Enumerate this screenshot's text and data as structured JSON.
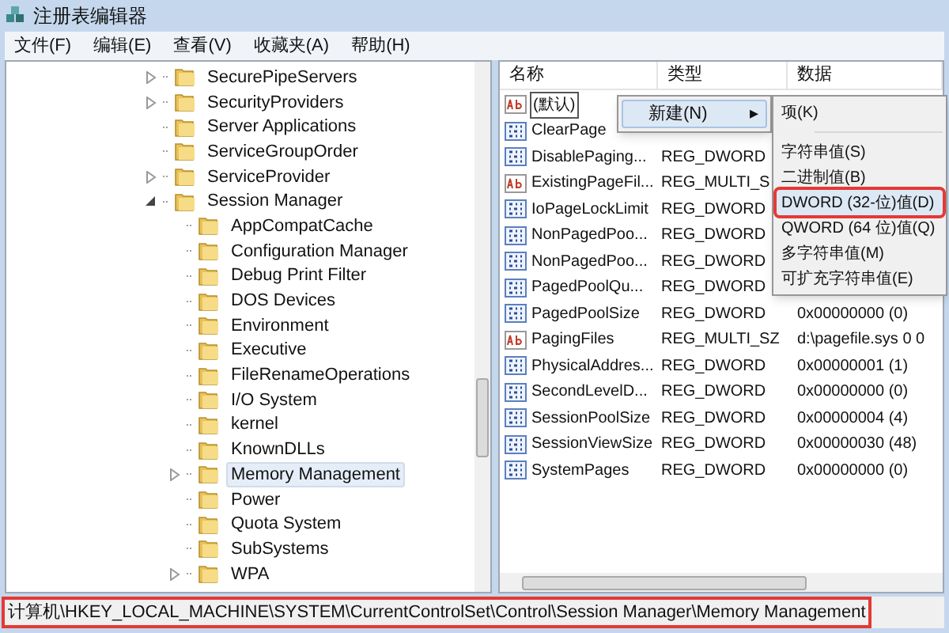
{
  "window": {
    "title": "注册表编辑器"
  },
  "menu": [
    "文件(F)",
    "编辑(E)",
    "查看(V)",
    "收藏夹(A)",
    "帮助(H)"
  ],
  "tree": [
    {
      "label": "SecurePipeServers",
      "expandable": true,
      "expanded": false,
      "selected": false
    },
    {
      "label": "SecurityProviders",
      "expandable": true,
      "expanded": false,
      "selected": false
    },
    {
      "label": "Server Applications",
      "expandable": false,
      "selected": false
    },
    {
      "label": "ServiceGroupOrder",
      "expandable": false,
      "selected": false
    },
    {
      "label": "ServiceProvider",
      "expandable": true,
      "expanded": false,
      "selected": false
    },
    {
      "label": "Session Manager",
      "expandable": true,
      "expanded": true,
      "selected": false,
      "children": [
        {
          "label": "AppCompatCache",
          "expandable": false,
          "selected": false
        },
        {
          "label": "Configuration Manager",
          "expandable": false,
          "selected": false
        },
        {
          "label": "Debug Print Filter",
          "expandable": false,
          "selected": false
        },
        {
          "label": "DOS Devices",
          "expandable": false,
          "selected": false
        },
        {
          "label": "Environment",
          "expandable": false,
          "selected": false
        },
        {
          "label": "Executive",
          "expandable": false,
          "selected": false
        },
        {
          "label": "FileRenameOperations",
          "expandable": false,
          "selected": false
        },
        {
          "label": "I/O System",
          "expandable": false,
          "selected": false
        },
        {
          "label": "kernel",
          "expandable": false,
          "selected": false
        },
        {
          "label": "KnownDLLs",
          "expandable": false,
          "selected": false
        },
        {
          "label": "Memory Management",
          "expandable": true,
          "expanded": false,
          "selected": true
        },
        {
          "label": "Power",
          "expandable": false,
          "selected": false
        },
        {
          "label": "Quota System",
          "expandable": false,
          "selected": false
        },
        {
          "label": "SubSystems",
          "expandable": false,
          "selected": false
        },
        {
          "label": "WPA",
          "expandable": true,
          "expanded": false,
          "selected": false
        }
      ]
    }
  ],
  "table": {
    "columns": [
      "名称",
      "类型",
      "数据"
    ],
    "rows": [
      {
        "kind": "string",
        "name": "(默认)",
        "editing": true
      },
      {
        "kind": "dword",
        "name": "ClearPage",
        "editing": false
      },
      {
        "kind": "dword",
        "name": "DisablePaging...",
        "type": "REG_DWORD",
        "editing": false
      },
      {
        "kind": "string",
        "name": "ExistingPageFil...",
        "type": "REG_MULTI_S",
        "editing": false
      },
      {
        "kind": "dword",
        "name": "IoPageLockLimit",
        "type": "REG_DWORD",
        "editing": false
      },
      {
        "kind": "dword",
        "name": "NonPagedPoo...",
        "type": "REG_DWORD",
        "editing": false
      },
      {
        "kind": "dword",
        "name": "NonPagedPoo...",
        "type": "REG_DWORD",
        "editing": false
      },
      {
        "kind": "dword",
        "name": "PagedPoolQu...",
        "type": "REG_DWORD",
        "editing": false
      },
      {
        "kind": "dword",
        "name": "PagedPoolSize",
        "type": "REG_DWORD",
        "data": "0x00000000 (0)",
        "editing": false
      },
      {
        "kind": "string",
        "name": "PagingFiles",
        "type": "REG_MULTI_SZ",
        "data": "d:\\pagefile.sys 0 0",
        "editing": false
      },
      {
        "kind": "dword",
        "name": "PhysicalAddres...",
        "type": "REG_DWORD",
        "data": "0x00000001 (1)",
        "editing": false
      },
      {
        "kind": "dword",
        "name": "SecondLevelD...",
        "type": "REG_DWORD",
        "data": "0x00000000 (0)",
        "editing": false
      },
      {
        "kind": "dword",
        "name": "SessionPoolSize",
        "type": "REG_DWORD",
        "data": "0x00000004 (4)",
        "editing": false
      },
      {
        "kind": "dword",
        "name": "SessionViewSize",
        "type": "REG_DWORD",
        "data": "0x00000030 (48)",
        "editing": false
      },
      {
        "kind": "dword",
        "name": "SystemPages",
        "type": "REG_DWORD",
        "data": "0x00000000 (0)",
        "editing": false
      }
    ]
  },
  "context_menu": {
    "label": "新建(N)",
    "arrow": "▸"
  },
  "submenu": [
    {
      "kind": "item",
      "label": "项(K)",
      "selected": false,
      "annotated": false
    },
    {
      "kind": "separator"
    },
    {
      "kind": "item",
      "label": "字符串值(S)",
      "selected": false,
      "annotated": false
    },
    {
      "kind": "item",
      "label": "二进制值(B)",
      "selected": false,
      "annotated": false
    },
    {
      "kind": "item",
      "label": "DWORD (32-位)值(D)",
      "selected": true,
      "annotated": true
    },
    {
      "kind": "item",
      "label": "QWORD (64 位)值(Q)",
      "selected": false,
      "annotated": false
    },
    {
      "kind": "item",
      "label": "多字符串值(M)",
      "selected": false,
      "annotated": false
    },
    {
      "kind": "item",
      "label": "可扩充字符串值(E)",
      "selected": false,
      "annotated": false
    }
  ],
  "status_bar": {
    "path": "计算机\\HKEY_LOCAL_MACHINE\\SYSTEM\\CurrentControlSet\\Control\\Session Manager\\Memory Management",
    "annotated": true
  }
}
